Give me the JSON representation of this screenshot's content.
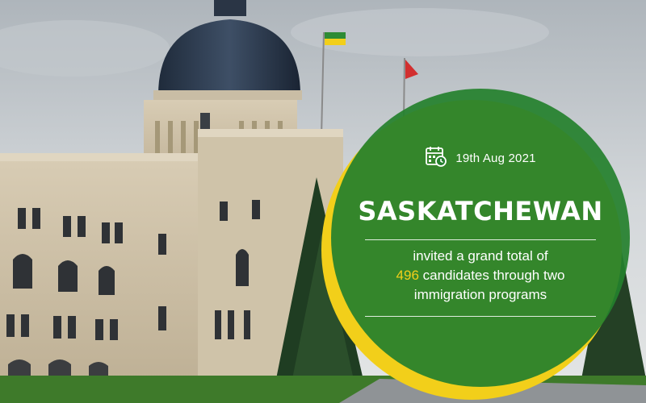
{
  "post": {
    "date": "19th Aug 2021",
    "province": "SASKATCHEWAN",
    "message_line1": "invited a grand total of",
    "count": "496",
    "message_line2_rest": " candidates through two",
    "message_line3": "immigration programs"
  },
  "icons": {
    "calendar": "calendar-clock-icon"
  },
  "colors": {
    "green": "#24802d",
    "yellow": "#f2cf1a",
    "text": "#ffffff"
  }
}
